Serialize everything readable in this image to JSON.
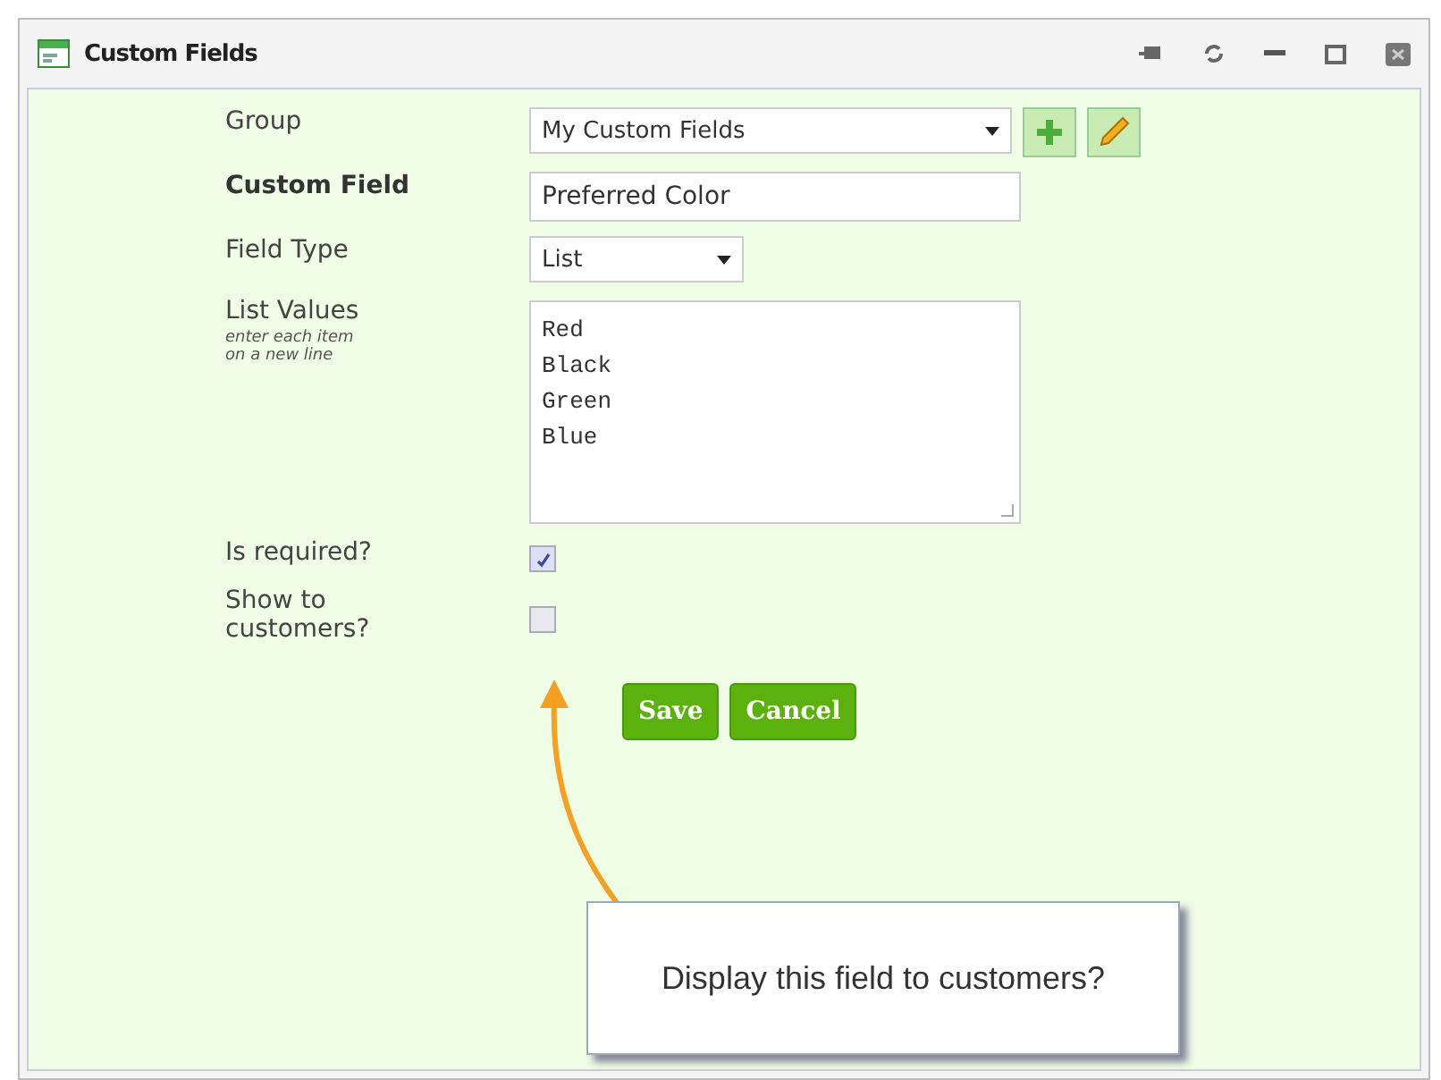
{
  "window": {
    "title": "Custom Fields"
  },
  "fields": [
    {
      "kind": "select",
      "label": "Group",
      "value": "My Custom Fields",
      "bold": false,
      "wide": true
    },
    {
      "kind": "text",
      "label": "Custom Field",
      "value": "Preferred Color",
      "bold": true
    },
    {
      "kind": "select",
      "label": "Field Type",
      "value": "List",
      "bold": false,
      "wide": false
    },
    {
      "kind": "textarea",
      "label": "List Values",
      "hint": [
        "enter each item",
        "on a new line"
      ],
      "lines": [
        "Red",
        "Black",
        "Green",
        "Blue"
      ],
      "bold": false
    },
    {
      "kind": "checkbox",
      "label": "Is required?",
      "checked": true,
      "bold": false
    },
    {
      "kind": "checkbox",
      "label": "Show to customers?",
      "checked": false,
      "bold": false
    }
  ],
  "buttons": [
    "Save",
    "Cancel"
  ],
  "callout": {
    "text": "Display this field to customers?"
  }
}
